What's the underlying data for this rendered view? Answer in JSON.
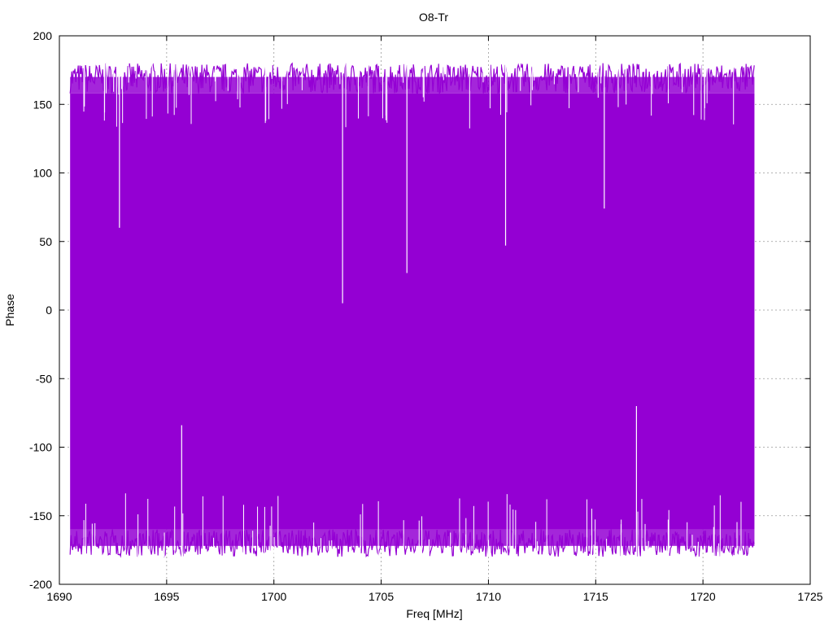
{
  "chart_data": {
    "type": "line",
    "title": "O8-Tr",
    "xlabel": "Freq [MHz]",
    "ylabel": "Phase",
    "xlim": [
      1690,
      1725
    ],
    "ylim": [
      -200,
      200
    ],
    "xticks": [
      1690,
      1695,
      1700,
      1705,
      1710,
      1715,
      1720,
      1725
    ],
    "yticks": [
      -200,
      -150,
      -100,
      -50,
      0,
      50,
      100,
      150,
      200
    ],
    "grid": true,
    "series": [
      {
        "color": "#9400d3",
        "x_range": [
          1690.5,
          1722.4
        ],
        "y_range": [
          -180,
          180
        ],
        "description_points": [
          {
            "x": 1692.8,
            "y": 60
          },
          {
            "x": 1703.2,
            "y": 5
          },
          {
            "x": 1706.2,
            "y": 27
          },
          {
            "x": 1710.8,
            "y": 47
          },
          {
            "x": 1715.4,
            "y": 74
          },
          {
            "x": 1716.9,
            "y": -70
          },
          {
            "x": 1695.7,
            "y": -84
          }
        ]
      }
    ]
  }
}
